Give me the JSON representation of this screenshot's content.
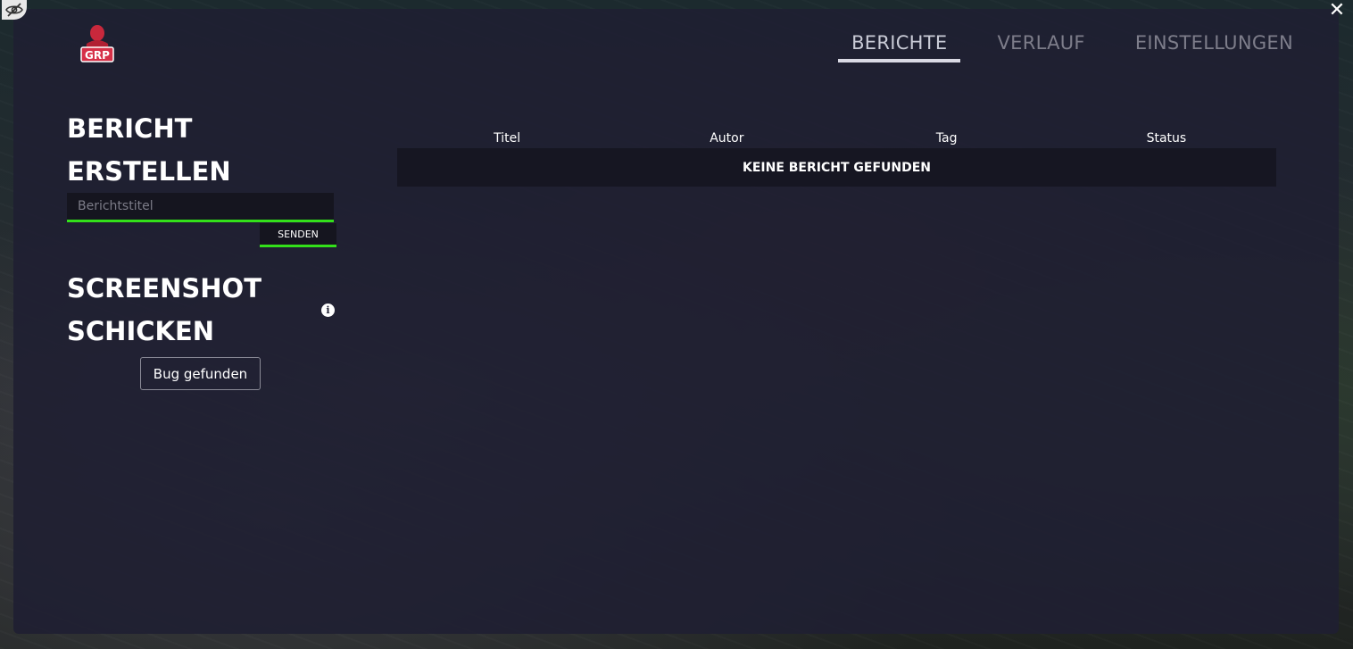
{
  "header": {
    "tabs": [
      {
        "label": "BERICHTE",
        "active": true
      },
      {
        "label": "VERLAUF",
        "active": false
      },
      {
        "label": "EINSTELLUNGEN",
        "active": false
      }
    ],
    "logo_text": "GRP"
  },
  "report": {
    "title_line1": "BERICHT",
    "title_line2": "ERSTELLEN",
    "input_placeholder": "Berichtstitel",
    "input_value": "",
    "send_label": "SENDEN"
  },
  "screenshot": {
    "title_line1": "SCREENSHOT",
    "title_line2": "SCHICKEN",
    "bug_button_label": "Bug gefunden"
  },
  "table": {
    "columns": [
      "Titel",
      "Autor",
      "Tag",
      "Status"
    ],
    "empty_message": "KEINE BERICHT GEFUNDEN"
  },
  "colors": {
    "accent_green": "#33e01a",
    "panel": "#1f1f32",
    "logo_red": "#c8283c"
  },
  "icons": {
    "top_left": "eye-slash-icon",
    "top_right": "close-icon",
    "info": "info-icon"
  }
}
